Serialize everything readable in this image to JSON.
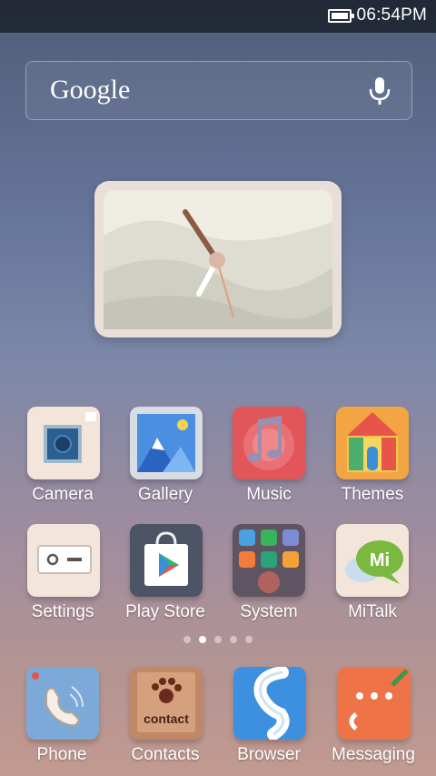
{
  "status": {
    "time": "06:54PM",
    "battery_level": 1.0
  },
  "search": {
    "logo_text": "Google",
    "mic_icon": "microphone-icon"
  },
  "home": {
    "page_indicator": {
      "count": 5,
      "active_index": 1
    },
    "grid_apps": [
      {
        "label": "Camera",
        "icon": "camera-icon"
      },
      {
        "label": "Gallery",
        "icon": "gallery-icon"
      },
      {
        "label": "Music",
        "icon": "music-icon"
      },
      {
        "label": "Themes",
        "icon": "themes-icon"
      },
      {
        "label": "Settings",
        "icon": "settings-icon"
      },
      {
        "label": "Play Store",
        "icon": "play-store-icon"
      },
      {
        "label": "System",
        "icon": "system-folder-icon"
      },
      {
        "label": "MiTalk",
        "icon": "mitalk-icon"
      }
    ],
    "dock_apps": [
      {
        "label": "Phone",
        "icon": "phone-icon"
      },
      {
        "label": "Contacts",
        "icon": "contacts-icon"
      },
      {
        "label": "Browser",
        "icon": "browser-icon"
      },
      {
        "label": "Messaging",
        "icon": "messaging-icon"
      }
    ],
    "mitalk_badge_text": "Mi",
    "contacts_icon_text": "contact"
  }
}
